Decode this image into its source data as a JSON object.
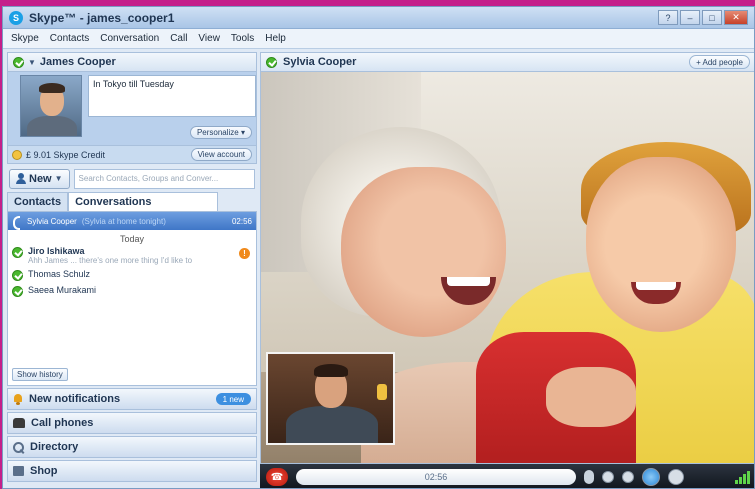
{
  "window": {
    "title": "Skype™ - james_cooper1",
    "controls": [
      "?",
      "–",
      "□",
      "✕"
    ]
  },
  "menu": [
    "Skype",
    "Contacts",
    "Conversation",
    "Call",
    "View",
    "Tools",
    "Help"
  ],
  "user": {
    "name": "James Cooper",
    "mood": "In Tokyo till Tuesday",
    "personalize_label": "Personalize ▾"
  },
  "credit": {
    "text": "£ 9.01 Skype Credit",
    "view_account_label": "View account"
  },
  "new_button": "New",
  "search": {
    "placeholder": "Search Contacts, Groups and Conver..."
  },
  "tabs": [
    "Contacts",
    "Conversations"
  ],
  "active_call": {
    "name": "Sylvia Cooper",
    "sub": "(Sylvia at home tonight)",
    "time": "02:56"
  },
  "today_label": "Today",
  "conversations": [
    {
      "name": "Jiro Ishikawa",
      "preview": "Ahh James ... there's one more thing I'd like to",
      "unread": "!"
    },
    {
      "name": "Thomas Schulz",
      "preview": ""
    },
    {
      "name": "Saeea Murakami",
      "preview": ""
    }
  ],
  "show_history_label": "Show history",
  "sections": {
    "notifications": "New notifications",
    "notifications_badge": "1 new",
    "call_phones": "Call phones",
    "directory": "Directory",
    "shop": "Shop"
  },
  "call": {
    "contact_name": "Sylvia Cooper",
    "add_people_label": "+ Add people",
    "timer": "02:56"
  },
  "colors": {
    "desktop": "#c41f8a",
    "accent": "#3f76c7",
    "online": "#4ab82e"
  }
}
